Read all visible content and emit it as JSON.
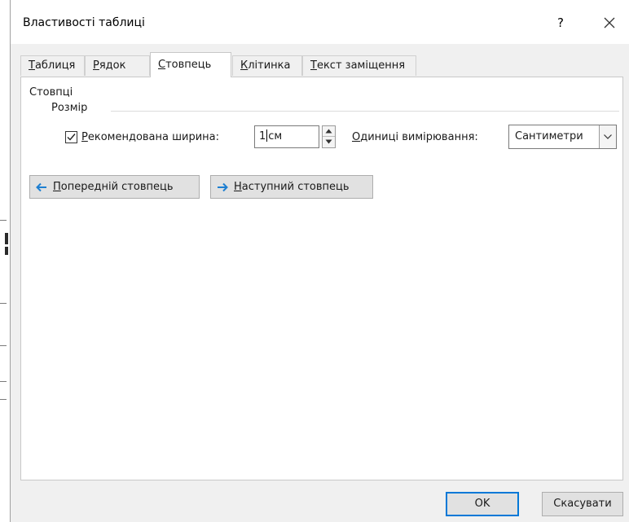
{
  "dialog": {
    "title": "Властивості таблиці",
    "help_label": "?",
    "close_label": "✕"
  },
  "tabs": [
    {
      "first": "Т",
      "rest": "аблиця"
    },
    {
      "first": "Р",
      "rest": "ядок"
    },
    {
      "first": "С",
      "rest": "товпець"
    },
    {
      "first": "К",
      "rest": "літинка"
    },
    {
      "first": "Т",
      "rest": "екст заміщення"
    }
  ],
  "active_tab_index": 2,
  "column": {
    "section_label": "Стовпці",
    "size_group_label": "Розмір",
    "preferred_width": {
      "checked": true,
      "label_first": "Р",
      "label_rest": "екомендована ширина:",
      "value_before_caret": "1",
      "value_after_caret": "см"
    },
    "units": {
      "label_first": "О",
      "label_rest": "диниці вимірювання:",
      "selected": "Сантиметри"
    },
    "prev_column": {
      "first": "П",
      "rest": "опередній стовпець"
    },
    "next_column": {
      "first": "Н",
      "rest": "аступний стовпець"
    }
  },
  "footer": {
    "ok_label": "OK",
    "cancel_label": "Скасувати"
  },
  "colors": {
    "accent": "#0078d7",
    "nav_arrow": "#1e7fd1"
  }
}
